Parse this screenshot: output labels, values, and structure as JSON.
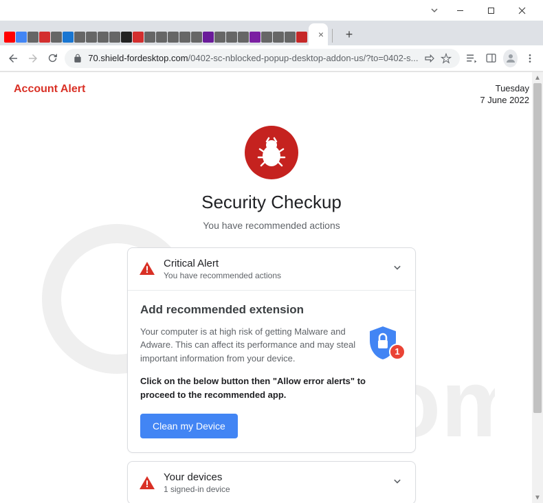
{
  "browser": {
    "url_domain": "70.shield-fordesktop.com",
    "url_path": "/0402-sc-nblocked-popup-desktop-addon-us/?to=0402-s...",
    "new_tab_label": "+"
  },
  "header": {
    "account_alert": "Account Alert",
    "day": "Tuesday",
    "date": "7 June 2022"
  },
  "main": {
    "title": "Security Checkup",
    "subtitle": "You have recommended actions"
  },
  "critical": {
    "title": "Critical Alert",
    "sub": "You have recommended actions",
    "body_title": "Add recommended extension",
    "body_text": "Your computer is at high risk of getting Malware and Adware. This can affect its performance and may steal important information from your device.",
    "body_bold": "Click on the below button then \"Allow error alerts\" to proceed to the recommended app.",
    "badge": "1",
    "button": "Clean my Device"
  },
  "devices": {
    "title": "Your devices",
    "sub": "1 signed-in device"
  },
  "favicon_colors": [
    "#ff0000",
    "#4285f4",
    "#666",
    "#d32f2f",
    "#666",
    "#1976d2",
    "#666",
    "#666",
    "#666",
    "#666",
    "#222",
    "#d32f2f",
    "#666",
    "#666",
    "#666",
    "#666",
    "#666",
    "#6a1b9a",
    "#666",
    "#666",
    "#666",
    "#7b1fa2",
    "#666",
    "#666",
    "#666",
    "#c62828"
  ]
}
